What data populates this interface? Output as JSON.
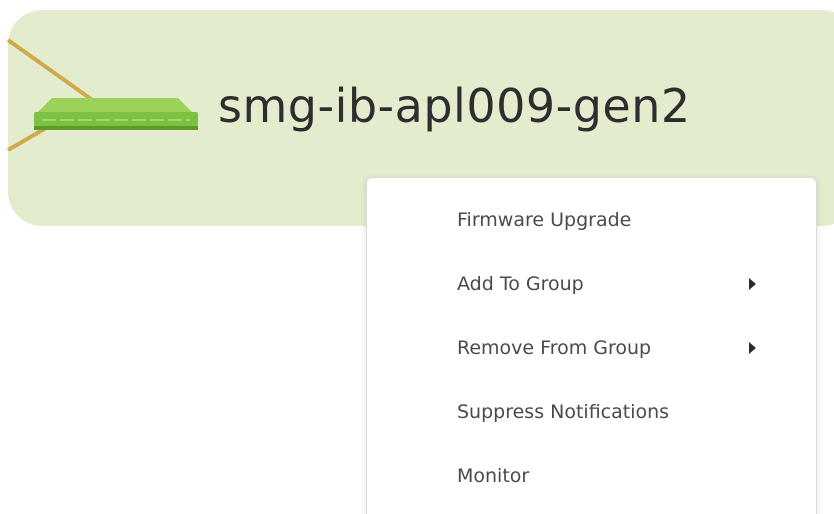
{
  "node": {
    "label": "smg-ib-apl009-gen2",
    "icon": "network-switch-icon",
    "card_color": "#e3edcd",
    "link_color": "#d1a94a",
    "switch_color": "#7cc242"
  },
  "context_menu": {
    "items": [
      {
        "label": "Firmware Upgrade",
        "has_submenu": false
      },
      {
        "label": "Add To Group",
        "has_submenu": true
      },
      {
        "label": "Remove From Group",
        "has_submenu": true
      },
      {
        "label": "Suppress Notifications",
        "has_submenu": false
      },
      {
        "label": "Monitor",
        "has_submenu": false
      }
    ],
    "submenu_icon": "caret-right-icon"
  }
}
